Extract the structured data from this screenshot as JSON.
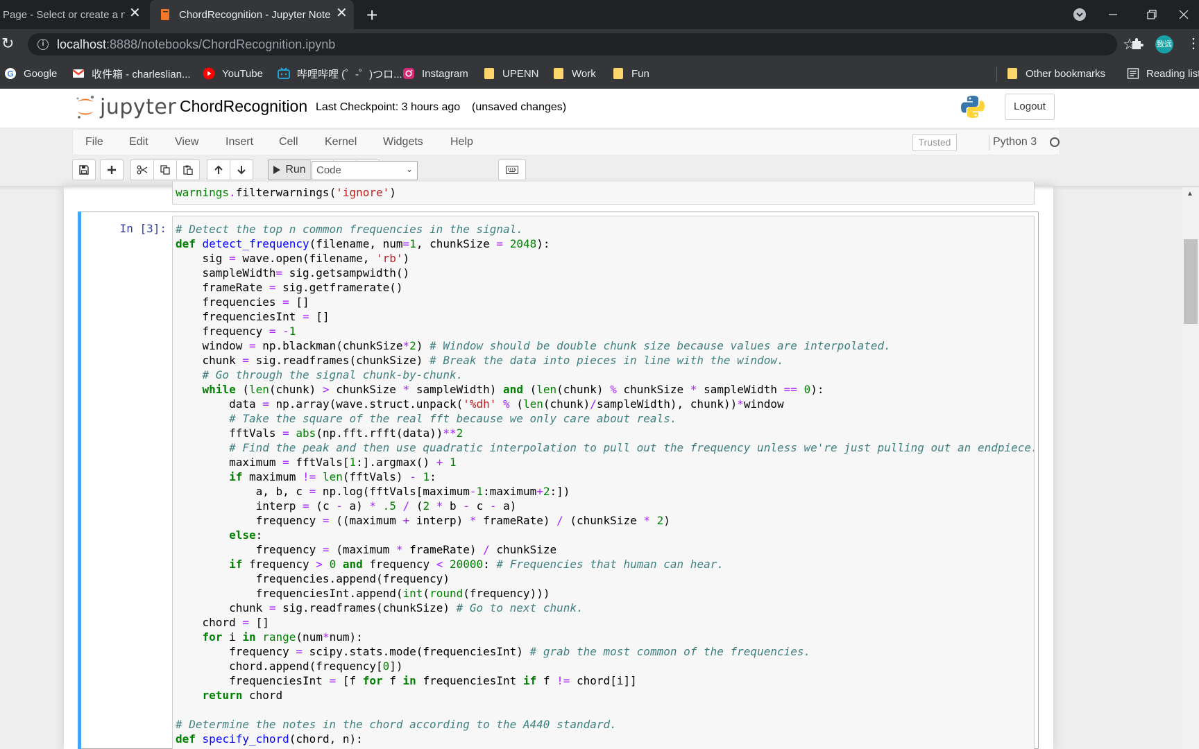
{
  "browser": {
    "tabs": [
      {
        "title": "Page - Select or create a n",
        "active": false
      },
      {
        "title": "ChordRecognition - Jupyter Note",
        "active": true
      }
    ],
    "new_tab": "+",
    "url_host": "localhost",
    "url_rest": ":8888/notebooks/ChordRecognition.ipynb",
    "profile_label": "致远",
    "bookmarks": [
      {
        "label": "Google",
        "icon": "google-icon"
      },
      {
        "label": "收件箱 - charleslian...",
        "icon": "gmail-icon"
      },
      {
        "label": "YouTube",
        "icon": "youtube-icon"
      },
      {
        "label": "哔哩哔哩 (゜-゜)つロ...",
        "icon": "bilibili-icon"
      },
      {
        "label": "Instagram",
        "icon": "instagram-icon"
      },
      {
        "label": "UPENN",
        "icon": "folder-icon"
      },
      {
        "label": "Work",
        "icon": "folder-icon"
      },
      {
        "label": "Fun",
        "icon": "folder-icon"
      }
    ],
    "other_bookmarks": "Other bookmarks",
    "reading_list": "Reading list"
  },
  "jupyter": {
    "logo_text": "jupyter",
    "notebook_name": "ChordRecognition",
    "checkpoint": "Last Checkpoint: 3 hours ago",
    "save_status": "(unsaved changes)",
    "logout": "Logout",
    "menu": [
      "File",
      "Edit",
      "View",
      "Insert",
      "Cell",
      "Kernel",
      "Widgets",
      "Help"
    ],
    "trusted": "Trusted",
    "kernel": "Python 3",
    "toolbar": {
      "run_label": "Run",
      "cell_type": "Code"
    }
  },
  "notebook": {
    "prev_cell_last_line": "warnings.filterwarnings('ignore')",
    "active_cell_prompt": "In [3]:",
    "code_lines": [
      "# Detect the top n common frequencies in the signal.",
      "def detect_frequency(filename, num=1, chunkSize = 2048):",
      "    sig = wave.open(filename, 'rb')",
      "    sampleWidth= sig.getsampwidth()",
      "    frameRate = sig.getframerate()",
      "    frequencies = []",
      "    frequenciesInt = []",
      "    frequency = -1",
      "    window = np.blackman(chunkSize*2) # Window should be double chunk size because values are interpolated.",
      "    chunk = sig.readframes(chunkSize) # Break the data into pieces in line with the window.",
      "    # Go through the signal chunk-by-chunk.",
      "    while (len(chunk) > chunkSize * sampleWidth) and (len(chunk) % chunkSize * sampleWidth == 0):",
      "        data = np.array(wave.struct.unpack('%dh' % (len(chunk)/sampleWidth), chunk))*window",
      "        # Take the square of the real fft because we only care about reals.",
      "        fftVals = abs(np.fft.rfft(data))**2",
      "        # Find the peak and then use quadratic interpolation to pull out the frequency unless we're just pulling out an endpiece.",
      "        maximum = fftVals[1:].argmax() + 1",
      "        if maximum != len(fftVals) - 1:",
      "            a, b, c = np.log(fftVals[maximum-1:maximum+2:])",
      "            interp = (c - a) * .5 / (2 * b - c - a)",
      "            frequency = ((maximum + interp) * frameRate) / (chunkSize * 2)",
      "        else:",
      "            frequency = (maximum * frameRate) / chunkSize",
      "        if frequency > 0 and frequency < 20000: # Frequencies that human can hear.",
      "            frequencies.append(frequency)",
      "            frequenciesInt.append(int(round(frequency)))",
      "        chunk = sig.readframes(chunkSize) # Go to next chunk.",
      "    chord = []",
      "    for i in range(num*num):",
      "        frequency = scipy.stats.mode(frequenciesInt) # grab the most common of the frequencies.",
      "        chord.append(frequency[0])",
      "        frequenciesInt = [f for f in frequenciesInt if f != chord[i]]",
      "    return chord",
      "",
      "# Determine the notes in the chord according to the A440 standard.",
      "def specify_chord(chord, n):"
    ]
  },
  "colors": {
    "selected_cell_bar": "#42a5f5",
    "keyword": "#008000",
    "function_name": "#0000ff",
    "string": "#ba2121",
    "comment": "#408080",
    "operator": "#aa22ff"
  }
}
